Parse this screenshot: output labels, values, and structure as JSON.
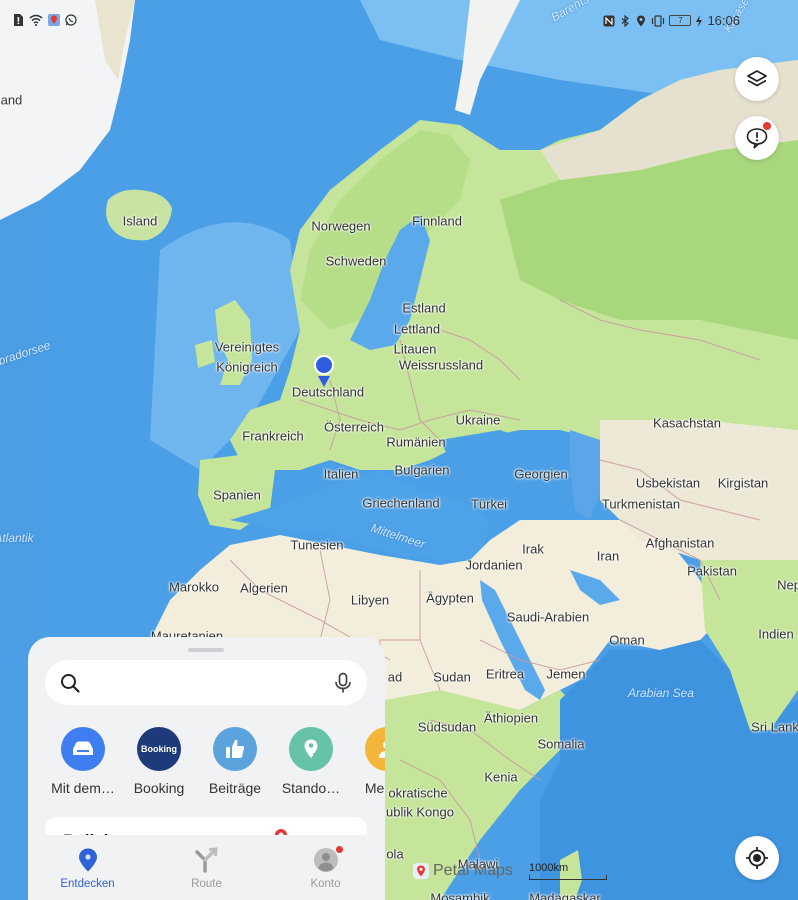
{
  "status_bar": {
    "left_icons": [
      "sim-alert-icon",
      "wifi-icon",
      "petal-maps-notification-icon",
      "whatsapp-icon"
    ],
    "right_icons": [
      "nfc-icon",
      "bluetooth-icon",
      "location-icon",
      "vibrate-icon"
    ],
    "battery_level": "7",
    "time": "16:06"
  },
  "map": {
    "country_labels": [
      {
        "name": "Grönland (partial)",
        "text": "land"
      },
      {
        "name": "Island",
        "text": "Island"
      },
      {
        "name": "Norwegen",
        "text": "Norwegen"
      },
      {
        "name": "Finnland",
        "text": "Finnland"
      },
      {
        "name": "Schweden",
        "text": "Schweden"
      },
      {
        "name": "Estland",
        "text": "Estland"
      },
      {
        "name": "Lettland",
        "text": "Lettland"
      },
      {
        "name": "Litauen",
        "text": "Litauen"
      },
      {
        "name": "Weissrussland",
        "text": "Weissrussland"
      },
      {
        "name": "Vereinigtes",
        "text": "Vereinigtes"
      },
      {
        "name": "Königreich",
        "text": "Königreich"
      },
      {
        "name": "Deutschland",
        "text": "Deutschland"
      },
      {
        "name": "Kasachstan",
        "text": "Kasachstan"
      },
      {
        "name": "Ukraine",
        "text": "Ukraine"
      },
      {
        "name": "Frankreich",
        "text": "Frankreich"
      },
      {
        "name": "Österreich",
        "text": "Österreich"
      },
      {
        "name": "Rumänien",
        "text": "Rumänien"
      },
      {
        "name": "Italien",
        "text": "Italien"
      },
      {
        "name": "Bulgarien",
        "text": "Bulgarien"
      },
      {
        "name": "Georgien",
        "text": "Georgien"
      },
      {
        "name": "Usbekistan",
        "text": "Usbekistan"
      },
      {
        "name": "Kirgistan",
        "text": "Kirgistan"
      },
      {
        "name": "Spanien",
        "text": "Spanien"
      },
      {
        "name": "Griechenland",
        "text": "Griechenland"
      },
      {
        "name": "Türkei",
        "text": "Türkei"
      },
      {
        "name": "Turkmenistan",
        "text": "Turkmenistan"
      },
      {
        "name": "Tunesien",
        "text": "Tunesien"
      },
      {
        "name": "Irak",
        "text": "Irak"
      },
      {
        "name": "Afghanistan",
        "text": "Afghanistan"
      },
      {
        "name": "Iran",
        "text": "Iran"
      },
      {
        "name": "Jordanien",
        "text": "Jordanien"
      },
      {
        "name": "Pakistan",
        "text": "Pakistan"
      },
      {
        "name": "Marokko",
        "text": "Marokko"
      },
      {
        "name": "Algerien",
        "text": "Algerien"
      },
      {
        "name": "Libyen",
        "text": "Libyen"
      },
      {
        "name": "Ägypten",
        "text": "Ägypten"
      },
      {
        "name": "Nepal (partial)",
        "text": "Nep"
      },
      {
        "name": "Saudi-Arabien",
        "text": "Saudi-Arabien"
      },
      {
        "name": "Oman",
        "text": "Oman"
      },
      {
        "name": "Indien",
        "text": "Indien"
      },
      {
        "name": "Tschad (partial)",
        "text": "ad"
      },
      {
        "name": "Sudan",
        "text": "Sudan"
      },
      {
        "name": "Eritrea",
        "text": "Eritrea"
      },
      {
        "name": "Jemen",
        "text": "Jemen"
      },
      {
        "name": "Sri Lanka (partial)",
        "text": "Sri Lank"
      },
      {
        "name": "Südsudan",
        "text": "Südsudan"
      },
      {
        "name": "Äthiopien",
        "text": "Äthiopien"
      },
      {
        "name": "Somalia",
        "text": "Somalia"
      },
      {
        "name": "Kenia",
        "text": "Kenia"
      },
      {
        "name": "Dem. Rep. Kongo line 1 (partial)",
        "text": "okratische"
      },
      {
        "name": "Dem. Rep. Kongo line 2 (partial)",
        "text": "ublik Kongo"
      },
      {
        "name": "Angola (partial)",
        "text": "ola"
      },
      {
        "name": "Malawi",
        "text": "Malawi"
      },
      {
        "name": "Mosambik (partial)",
        "text": "Mosambik"
      },
      {
        "name": "Madagaskar (partial)",
        "text": "Madagaskar"
      },
      {
        "name": "Mauretanien (partial)",
        "text": "Mauretanien"
      }
    ],
    "sea_labels": [
      {
        "text": "Barents"
      },
      {
        "text": "Karasee"
      },
      {
        "text": "Labradorsee"
      },
      {
        "text": "Atlantik"
      },
      {
        "text": "Mittelmeer"
      },
      {
        "text": "Arabian Sea"
      }
    ],
    "scale_label": "1000km",
    "brand_logo_text": "Petal Maps",
    "current_location_marker": "Deutschland",
    "colors": {
      "ocean": "#4a9fe6",
      "ocean_shallow": "#8ccbf6",
      "land_green": "#c4e59a",
      "land_forest": "#a7d77a",
      "desert": "#f3eedc",
      "tundra": "#e6e1cf",
      "ice": "#f5f6f7",
      "border": "#c99aa0",
      "location_blue": "#2e5de0"
    }
  },
  "floating_buttons": {
    "layers": {
      "icon": "layers-icon"
    },
    "feedback": {
      "icon": "feedback-alert-icon",
      "has_badge": true
    },
    "locate": {
      "icon": "my-location-icon"
    }
  },
  "bottom_sheet": {
    "search": {
      "placeholder": "",
      "value": "",
      "icon": "search-icon",
      "voice_icon": "microphone-icon"
    },
    "shortcuts": [
      {
        "label": "Mit dem…",
        "icon": "car-icon",
        "color": "#3f7ef0"
      },
      {
        "label": "Booking",
        "icon": "booking-logo",
        "icon_text": "Booking",
        "color": "#1d3a7a"
      },
      {
        "label": "Beiträge",
        "icon": "thumbs-up-icon",
        "color": "#5aa3dc"
      },
      {
        "label": "Stando…",
        "icon": "location-share-icon",
        "color": "#67c3a8"
      },
      {
        "label": "Mein…",
        "icon": "person-icon",
        "color": "#f3b63b"
      }
    ],
    "card_title": "Beliebt"
  },
  "tab_bar": {
    "tabs": [
      {
        "label": "Entdecken",
        "icon": "explore-pin-icon",
        "active": true
      },
      {
        "label": "Route",
        "icon": "route-fork-icon",
        "active": false
      },
      {
        "label": "Konto",
        "icon": "account-avatar-icon",
        "active": false,
        "has_badge": true
      }
    ],
    "active_color": "#2f62d6",
    "inactive_color": "#9a9a9a"
  }
}
